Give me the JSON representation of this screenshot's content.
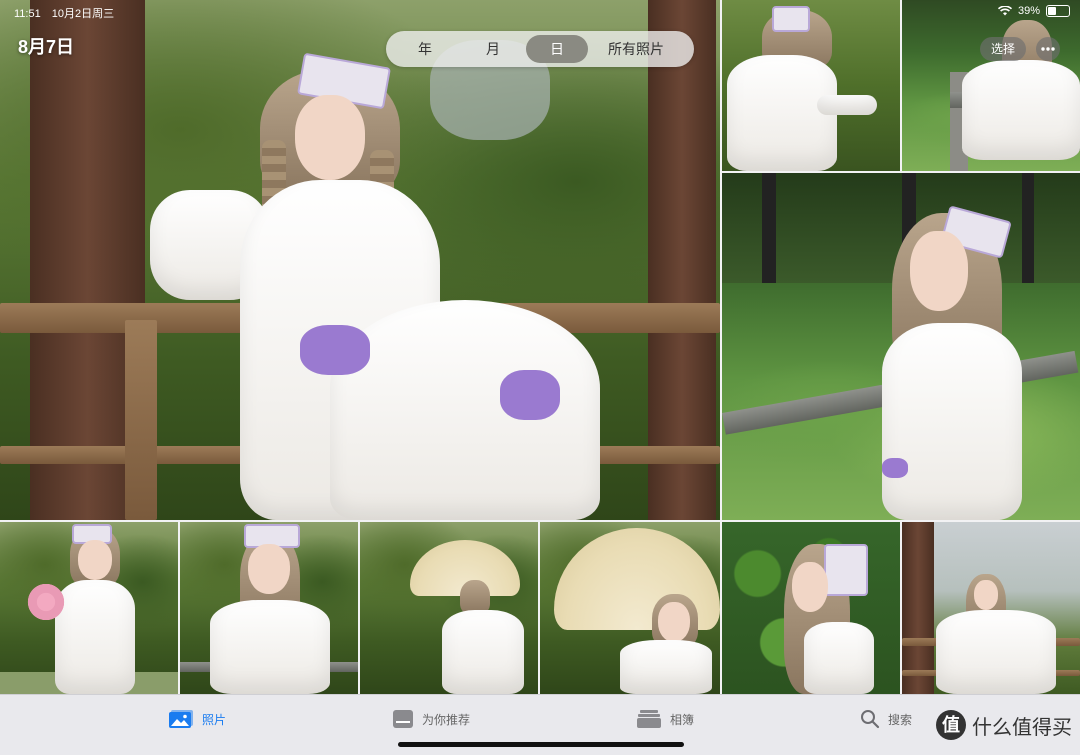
{
  "status_bar": {
    "time": "11:51",
    "date": "10月2日周三",
    "battery": "39%"
  },
  "header": {
    "date_title": "8月7日",
    "segments": [
      "年",
      "月",
      "日",
      "所有照片"
    ],
    "active_segment": "日",
    "select_label": "选择",
    "more_icon": "ellipsis-icon"
  },
  "tab_bar": {
    "tabs": [
      {
        "label": "照片",
        "icon": "photos-icon",
        "active": true
      },
      {
        "label": "为你推荐",
        "icon": "for-you-icon",
        "active": false
      },
      {
        "label": "相簿",
        "icon": "albums-icon",
        "active": false
      },
      {
        "label": "搜索",
        "icon": "search-icon",
        "active": false
      }
    ]
  },
  "watermark": {
    "logo": "值",
    "text": "什么值得买"
  }
}
